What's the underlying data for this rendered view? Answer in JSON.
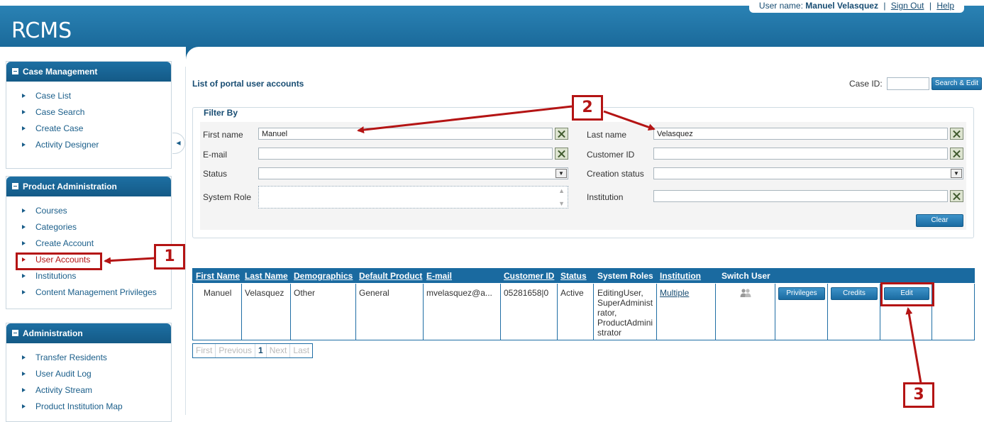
{
  "app": {
    "title": "RCMS"
  },
  "userbar": {
    "label": "User name:",
    "user": "Manuel Velasquez",
    "sign_out": "Sign Out",
    "help": "Help",
    "sep": "|"
  },
  "sidebar": {
    "case_management": {
      "title": "Case Management",
      "items": [
        "Case List",
        "Case Search",
        "Create Case",
        "Activity Designer"
      ]
    },
    "product_administration": {
      "title": "Product Administration",
      "items": [
        "Courses",
        "Categories",
        "Create Account",
        "User Accounts",
        "Institutions",
        "Content Management Privileges"
      ]
    },
    "administration": {
      "title": "Administration",
      "items": [
        "Transfer Residents",
        "User Audit Log",
        "Activity Stream",
        "Product Institution Map"
      ]
    }
  },
  "main": {
    "title": "List of portal user accounts",
    "case_id_label": "Case ID:",
    "case_id_value": "",
    "search_edit_label": "Search & Edit"
  },
  "filter": {
    "legend": "Filter By",
    "first_name_label": "First name",
    "first_name_value": "Manuel",
    "last_name_label": "Last name",
    "last_name_value": "Velasquez",
    "email_label": "E-mail",
    "email_value": "",
    "customer_id_label": "Customer ID",
    "customer_id_value": "",
    "status_label": "Status",
    "status_value": "",
    "creation_status_label": "Creation status",
    "creation_status_value": "",
    "system_role_label": "System Role",
    "institution_label": "Institution",
    "institution_value": "",
    "clear_label": "Clear"
  },
  "table": {
    "columns": [
      "First Name",
      "Last Name",
      "Demographics",
      "Default Product",
      "E-mail",
      "Customer ID",
      "Status",
      "System Roles",
      "Institution",
      "Switch User"
    ],
    "row": {
      "first_name": "Manuel",
      "last_name": "Velasquez",
      "demographics": "Other",
      "default_product": "General",
      "email": "mvelasquez@a...",
      "customer_id": "05281658|0",
      "status": "Active",
      "system_roles": [
        "EditingUser,",
        "SuperAdminist",
        "rator,",
        "ProductAdmini",
        "strator"
      ],
      "institution": "Multiple",
      "privileges_label": "Privileges",
      "credits_label": "Credits",
      "edit_label": "Edit"
    }
  },
  "pager": {
    "first": "First",
    "previous": "Previous",
    "current": "1",
    "next": "Next",
    "last": "Last"
  },
  "annotations": {
    "one": "1",
    "two": "2",
    "three": "3"
  },
  "colors": {
    "header": "#1a6aa0",
    "annotation": "#b41414",
    "link": "#174c72"
  }
}
